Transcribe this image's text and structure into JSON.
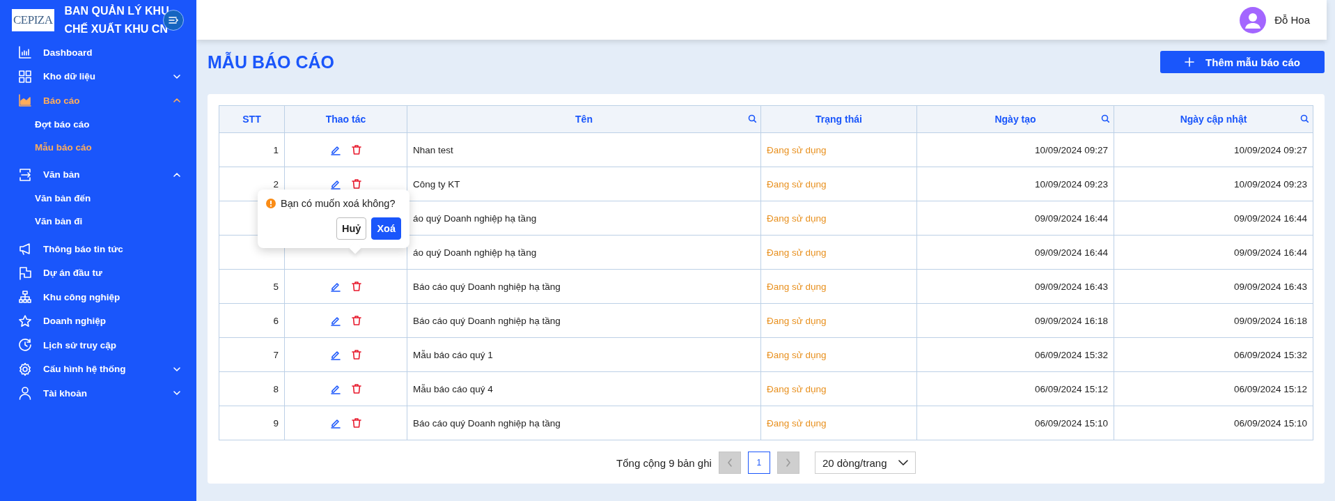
{
  "sidebar": {
    "logo": "CEPIZA",
    "title_lines": [
      "BAN QUẢN LÝ KHU",
      "CHẾ XUẤT KHU CN"
    ],
    "items": [
      {
        "label": "Dashboard",
        "selected": false
      },
      {
        "label": "Kho dữ liệu",
        "selected": false,
        "expanded": false
      },
      {
        "label": "Báo cáo",
        "selected": true,
        "expanded": true,
        "children": [
          {
            "label": "Đợt báo cáo",
            "selected": false
          },
          {
            "label": "Mẫu báo cáo",
            "selected": true
          }
        ]
      },
      {
        "label": "Văn bản",
        "selected": false,
        "expanded": true,
        "children": [
          {
            "label": "Văn bản đến",
            "selected": false
          },
          {
            "label": "Văn bản đi",
            "selected": false
          }
        ]
      },
      {
        "label": "Thông báo tin tức",
        "selected": false
      },
      {
        "label": "Dự án đầu tư",
        "selected": false
      },
      {
        "label": "Khu công nghiệp",
        "selected": false
      },
      {
        "label": "Doanh nghiệp",
        "selected": false
      },
      {
        "label": "Lịch sử truy cập",
        "selected": false
      },
      {
        "label": "Cấu hình hệ thống",
        "selected": false,
        "expanded": false
      },
      {
        "label": "Tài khoản",
        "selected": false,
        "expanded": false
      }
    ]
  },
  "header": {
    "user": "Đỗ Hoa"
  },
  "page": {
    "title": "MẪU BÁO CÁO",
    "add_button": "Thêm mẫu báo cáo"
  },
  "table": {
    "columns": [
      {
        "label": "STT",
        "searchable": false
      },
      {
        "label": "Thao tác",
        "searchable": false
      },
      {
        "label": "Tên",
        "searchable": true
      },
      {
        "label": "Trạng thái",
        "searchable": false
      },
      {
        "label": "Ngày tạo",
        "searchable": true
      },
      {
        "label": "Ngày cập nhật",
        "searchable": true
      }
    ],
    "rows": [
      {
        "stt": "1",
        "actions": true,
        "name": "Nhan test",
        "status": "Đang sử dụng",
        "created": "10/09/2024 09:27",
        "updated": "10/09/2024 09:27"
      },
      {
        "stt": "2",
        "actions": true,
        "name": "Công ty KT",
        "status": "Đang sử dụng",
        "created": "10/09/2024 09:23",
        "updated": "10/09/2024 09:23"
      },
      {
        "actions": false,
        "name": "áo quý Doanh nghiệp hạ tầng",
        "status": "Đang sử dụng",
        "created": "09/09/2024 16:44",
        "updated": "09/09/2024 16:44"
      },
      {
        "actions": false,
        "name": "áo quý Doanh nghiệp hạ tầng",
        "status": "Đang sử dụng",
        "created": "09/09/2024 16:44",
        "updated": "09/09/2024 16:44"
      },
      {
        "stt": "5",
        "actions": true,
        "name": "Báo cáo quý Doanh nghiệp hạ tầng",
        "status": "Đang sử dụng",
        "created": "09/09/2024 16:43",
        "updated": "09/09/2024 16:43"
      },
      {
        "stt": "6",
        "actions": true,
        "name": "Báo cáo quý Doanh nghiệp hạ tầng",
        "status": "Đang sử dụng",
        "created": "09/09/2024 16:18",
        "updated": "09/09/2024 16:18"
      },
      {
        "stt": "7",
        "actions": true,
        "name": "Mẫu báo cáo quý 1",
        "status": "Đang sử dụng",
        "created": "06/09/2024 15:32",
        "updated": "06/09/2024 15:32"
      },
      {
        "stt": "8",
        "actions": true,
        "name": "Mẫu báo cáo quý 4",
        "status": "Đang sử dụng",
        "created": "06/09/2024 15:12",
        "updated": "06/09/2024 15:12"
      },
      {
        "stt": "9",
        "actions": true,
        "name": "Báo cáo quý Doanh nghiệp hạ tầng",
        "status": "Đang sử dụng",
        "created": "06/09/2024 15:10",
        "updated": "06/09/2024 15:10"
      }
    ]
  },
  "confirm": {
    "message": "Bạn có muốn xoá không?",
    "cancel": "Huỷ",
    "ok": "Xoá"
  },
  "pagination": {
    "total": "Tổng cộng 9 bản ghi",
    "prev_disabled": true,
    "next_disabled": true,
    "pages": [
      {
        "label": "1",
        "selected": true
      }
    ],
    "page_size": "20 dòng/trang"
  }
}
